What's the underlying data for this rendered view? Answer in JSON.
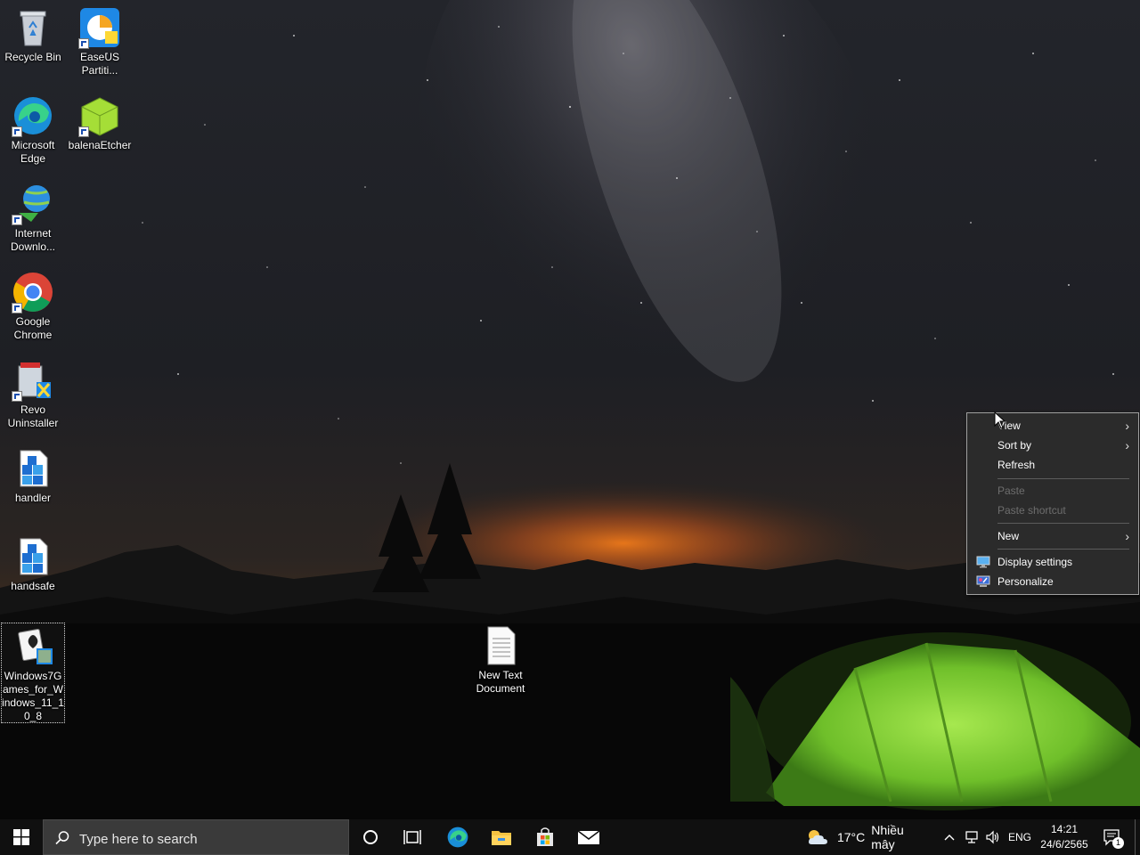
{
  "desktop": {
    "icons": [
      {
        "label": "Recycle Bin"
      },
      {
        "label": "EaseUS Partiti..."
      },
      {
        "label": "Microsoft Edge"
      },
      {
        "label": "balenaEtcher"
      },
      {
        "label": "Internet Downlo..."
      },
      {
        "label": "Google Chrome"
      },
      {
        "label": "Revo Uninstaller"
      },
      {
        "label": "handler"
      },
      {
        "label": "handsafe"
      },
      {
        "label": "Windows7Games_for_Windows_11_10_8"
      },
      {
        "label": "New Text Document"
      }
    ]
  },
  "context_menu": {
    "items": [
      {
        "label": "View",
        "has_submenu": true,
        "enabled": true
      },
      {
        "label": "Sort by",
        "has_submenu": true,
        "enabled": true
      },
      {
        "label": "Refresh",
        "has_submenu": false,
        "enabled": true
      },
      {
        "label": "Paste",
        "has_submenu": false,
        "enabled": false
      },
      {
        "label": "Paste shortcut",
        "has_submenu": false,
        "enabled": false
      },
      {
        "label": "New",
        "has_submenu": true,
        "enabled": true
      },
      {
        "label": "Display settings",
        "has_submenu": false,
        "enabled": true,
        "icon": "display-icon"
      },
      {
        "label": "Personalize",
        "has_submenu": false,
        "enabled": true,
        "icon": "personalize-icon"
      }
    ]
  },
  "taskbar": {
    "search_placeholder": "Type here to search",
    "pinned": [
      "cortana-icon",
      "task-view-icon",
      "edge-icon",
      "file-explorer-icon",
      "microsoft-store-icon",
      "mail-icon"
    ],
    "weather": {
      "temp": "17°C",
      "condition": "Nhiều mây"
    },
    "language": "ENG",
    "clock": {
      "time": "14:21",
      "date": "24/6/2565"
    },
    "notification_count": "1"
  },
  "colors": {
    "accent": "#0078d7",
    "menu_bg": "#2b2b2b",
    "taskbar_bg": "#101010",
    "tent_green": "#7fd13b"
  }
}
